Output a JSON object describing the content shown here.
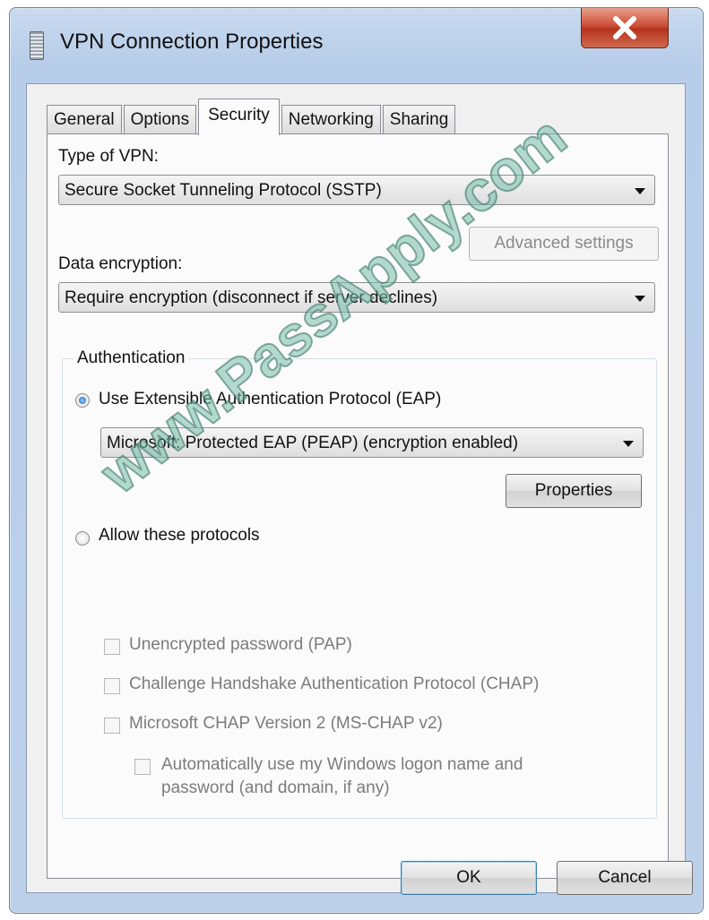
{
  "window": {
    "title": "VPN Connection Properties",
    "close_label": "X"
  },
  "tabs": [
    {
      "label": "General",
      "active": false
    },
    {
      "label": "Options",
      "active": false
    },
    {
      "label": "Security",
      "active": true
    },
    {
      "label": "Networking",
      "active": false
    },
    {
      "label": "Sharing",
      "active": false
    }
  ],
  "security": {
    "vpn_type_label": "Type of VPN:",
    "vpn_type_value": "Secure Socket Tunneling Protocol (SSTP)",
    "advanced_settings_label": "Advanced settings",
    "data_encryption_label": "Data encryption:",
    "data_encryption_value": "Require encryption (disconnect if server declines)",
    "authentication": {
      "group_label": "Authentication",
      "use_eap_label": "Use Extensible Authentication Protocol (EAP)",
      "use_eap_selected": true,
      "eap_method_value": "Microsoft: Protected EAP (PEAP) (encryption enabled)",
      "properties_label": "Properties",
      "allow_protocols_label": "Allow these protocols",
      "allow_protocols_selected": false,
      "protocols": [
        {
          "label": "Unencrypted password (PAP)",
          "checked": false,
          "enabled": false
        },
        {
          "label": "Challenge Handshake Authentication Protocol (CHAP)",
          "checked": false,
          "enabled": false
        },
        {
          "label": "Microsoft CHAP Version 2 (MS-CHAP v2)",
          "checked": false,
          "enabled": false
        }
      ],
      "auto_logon_label_line1": "Automatically use my Windows logon name and",
      "auto_logon_label_line2": "password (and domain, if any)",
      "auto_logon_checked": false
    }
  },
  "footer": {
    "ok_label": "OK",
    "cancel_label": "Cancel"
  },
  "watermark": "www.PassApply.com",
  "colors": {
    "titlebar": "#bcd0ea",
    "close_button": "#c7442c",
    "dialog_background": "#f0f0f0",
    "radio_selected": "#1d5fa5",
    "watermark": "#78beaa"
  },
  "icons": [
    "vpn-app-icon",
    "close-icon",
    "dropdown-arrow-icon"
  ]
}
